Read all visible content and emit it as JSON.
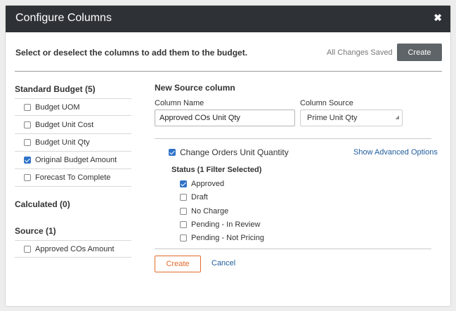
{
  "modal": {
    "title": "Configure Columns",
    "close_icon": "close-icon",
    "instruction": "Select or deselect the columns to add them to the budget.",
    "save_status": "All Changes Saved",
    "create_label": "Create"
  },
  "left": {
    "standard_title": "Standard Budget (5)",
    "standard_items": [
      {
        "label": "Budget UOM",
        "checked": false
      },
      {
        "label": "Budget Unit Cost",
        "checked": false
      },
      {
        "label": "Budget Unit Qty",
        "checked": false
      },
      {
        "label": "Original Budget Amount",
        "checked": true
      },
      {
        "label": "Forecast To Complete",
        "checked": false
      }
    ],
    "calculated_title": "Calculated (0)",
    "source_title": "Source (1)",
    "source_items": [
      {
        "label": "Approved COs Amount",
        "checked": false
      }
    ]
  },
  "form": {
    "title": "New Source column",
    "column_name_label": "Column Name",
    "column_name_value": "Approved COs Unit Qty",
    "column_source_label": "Column Source",
    "column_source_value": "Prime Unit Qty",
    "change_orders_label": "Change Orders Unit Quantity",
    "change_orders_checked": true,
    "advanced_link": "Show Advanced Options",
    "status_title": "Status (1 Filter Selected)",
    "statuses": [
      {
        "label": "Approved",
        "checked": true
      },
      {
        "label": "Draft",
        "checked": false
      },
      {
        "label": "No Charge",
        "checked": false
      },
      {
        "label": "Pending - In Review",
        "checked": false
      },
      {
        "label": "Pending - Not Pricing",
        "checked": false
      }
    ],
    "create_label": "Create",
    "cancel_label": "Cancel"
  },
  "colors": {
    "header_bg": "#2e3237",
    "accent_blue": "#2f73c8",
    "link_blue": "#1f5c9e",
    "create_orange": "#e26a2c",
    "create_gray": "#5f6468"
  }
}
